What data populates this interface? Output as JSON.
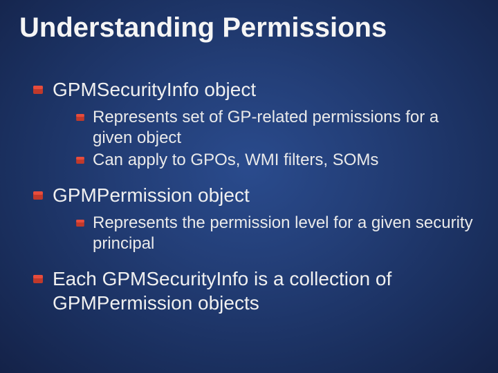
{
  "title": "Understanding Permissions",
  "items": [
    {
      "text": "GPMSecurityInfo object",
      "children": [
        {
          "text": "Represents set of GP-related permissions for a given object"
        },
        {
          "text": "Can apply to GPOs, WMI filters, SOMs"
        }
      ]
    },
    {
      "text": "GPMPermission object",
      "children": [
        {
          "text": "Represents the permission level for a given security principal"
        }
      ]
    },
    {
      "text": "Each GPMSecurityInfo is a collection of GPMPermission objects",
      "children": []
    }
  ]
}
